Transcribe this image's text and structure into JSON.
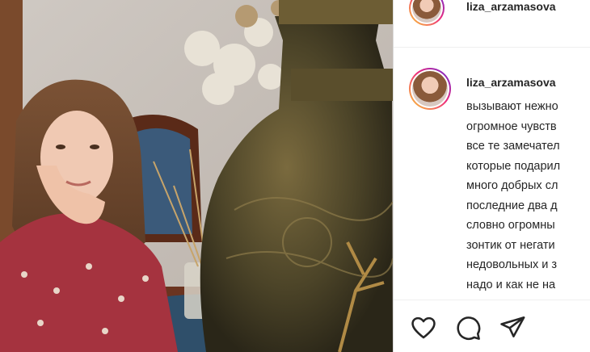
{
  "post": {
    "username": "liza_arzamasova"
  },
  "caption": {
    "username": "liza_arzamasova",
    "lines": [
      "вызывают нежно",
      "огромное чувств",
      "все те замечател",
      "которые подарил",
      "много добрых сл",
      "последние два д",
      "словно огромны",
      "зонтик от негати",
      "недовольных и з",
      "надо и как не на"
    ]
  },
  "actions": {
    "like_icon": "heart-icon",
    "comment_icon": "comment-icon",
    "share_icon": "paper-plane-icon"
  },
  "colors": {
    "text": "#262626",
    "border": "#dbdbdb",
    "story_ring_start": "#f9ce34",
    "story_ring_end": "#6228d7"
  }
}
